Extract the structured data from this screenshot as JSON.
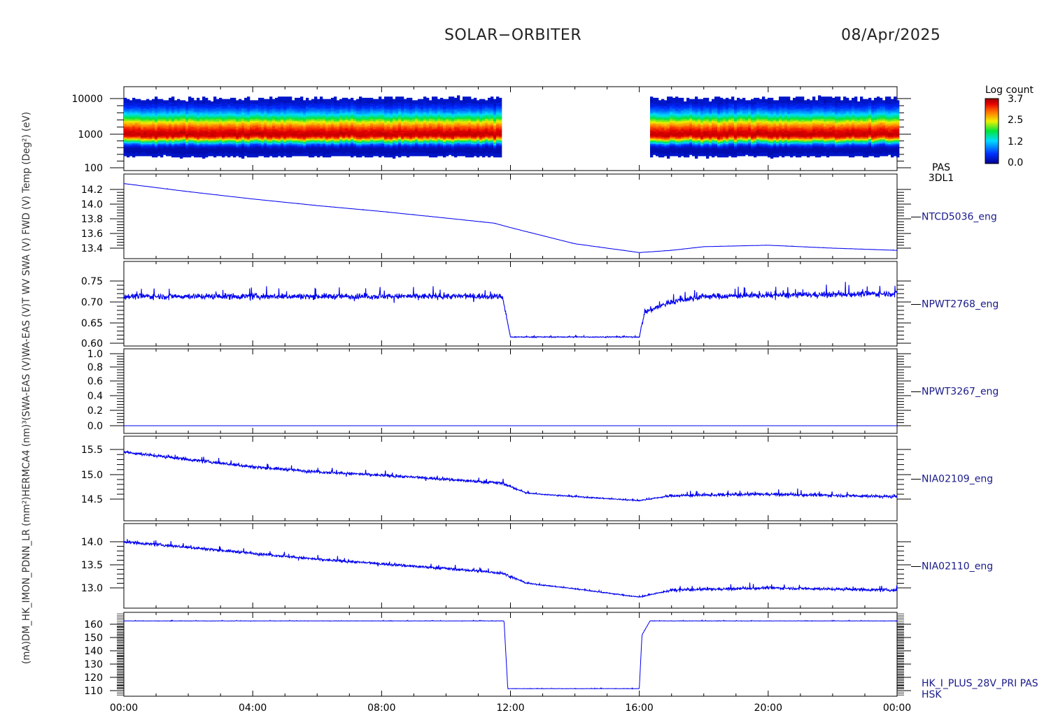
{
  "header": {
    "title": "SOLAR−ORBITER",
    "date": "08/Apr/2025"
  },
  "left_axis_label_overlay": "(mA)DM_HK_IMON_PDNN_LR (mm²)HERMCA4 (nm)³(SWA-EAS (V)WA-EAS (V)T WV SWA (V) FWD (V) Temp (Deg²) (eV)",
  "colorbar": {
    "title": "Log count",
    "ticks": [
      "3.7",
      "2.5",
      "1.2",
      "0.0"
    ]
  },
  "colors": {
    "trace": "#0000ee",
    "axis": "#000000",
    "label": "#1a1a8a"
  },
  "chart_data": [
    {
      "type": "heatmap",
      "panel": "PAS 3DL1",
      "name_lines": [
        "PAS",
        "3DL1"
      ],
      "y_scale": "log",
      "yticks": [
        "10000",
        "1000",
        "100"
      ],
      "ylim": [
        100,
        20000
      ],
      "x_range_hours": [
        0,
        24
      ],
      "data_gap_hours": [
        11.8,
        16.3
      ],
      "peak_energy": 900,
      "colorbar_range": [
        0.0,
        3.7
      ]
    },
    {
      "type": "line",
      "panel": "NTCD5036_eng",
      "name": "NTCD5036_eng",
      "yticks": [
        "14.2",
        "14.0",
        "13.8",
        "13.6",
        "13.4"
      ],
      "ylim": [
        13.3,
        14.33
      ],
      "x": [
        "00:00",
        "02:00",
        "04:00",
        "06:00",
        "08:00",
        "10:00",
        "11:30",
        "12:00",
        "14:00",
        "16:00",
        "17:00",
        "18:00",
        "20:00",
        "22:00",
        "24:00"
      ],
      "y": [
        14.28,
        14.17,
        14.07,
        13.98,
        13.9,
        13.81,
        13.74,
        13.68,
        13.46,
        13.34,
        13.37,
        13.42,
        13.44,
        13.4,
        13.37
      ]
    },
    {
      "type": "line",
      "panel": "NPWT2768_eng",
      "name": "NPWT2768_eng",
      "yticks": [
        "0.75",
        "0.70",
        "0.65",
        "0.60"
      ],
      "ylim": [
        0.598,
        0.78
      ],
      "x": [
        "00:00",
        "11:45",
        "12:00",
        "16:00",
        "16:10",
        "17:00",
        "18:00",
        "24:00"
      ],
      "y": [
        0.713,
        0.713,
        0.615,
        0.615,
        0.675,
        0.7,
        0.713,
        0.72
      ]
    },
    {
      "type": "line",
      "panel": "NPWT3267_eng",
      "name": "NPWT3267_eng",
      "yticks": [
        "1.0",
        "0.8",
        "0.6",
        "0.4",
        "0.2",
        "0.0"
      ],
      "ylim": [
        -0.02,
        1.02
      ],
      "x": [
        "00:00",
        "24:00"
      ],
      "y": [
        0.0,
        0.0
      ]
    },
    {
      "type": "line",
      "panel": "NIA02109_eng",
      "name": "NIA02109_eng",
      "yticks": [
        "15.5",
        "15.0",
        "14.5"
      ],
      "ylim": [
        14.1,
        15.65
      ],
      "x": [
        "00:00",
        "02:00",
        "04:00",
        "06:00",
        "08:00",
        "10:00",
        "11:45",
        "12:30",
        "14:00",
        "16:00",
        "17:00",
        "20:00",
        "24:00"
      ],
      "y": [
        15.45,
        15.3,
        15.15,
        15.05,
        14.98,
        14.9,
        14.82,
        14.62,
        14.55,
        14.47,
        14.57,
        14.6,
        14.55
      ]
    },
    {
      "type": "line",
      "panel": "NIA02110_eng",
      "name": "NIA02110_eng",
      "yticks": [
        "14.0",
        "13.5",
        "13.0"
      ],
      "ylim": [
        12.6,
        14.2
      ],
      "x": [
        "00:00",
        "02:00",
        "04:00",
        "06:00",
        "08:00",
        "10:00",
        "11:45",
        "12:30",
        "14:00",
        "16:00",
        "17:00",
        "20:00",
        "24:00"
      ],
      "y": [
        14.0,
        13.88,
        13.75,
        13.62,
        13.52,
        13.42,
        13.32,
        13.1,
        12.98,
        12.8,
        12.95,
        13.0,
        12.95
      ]
    },
    {
      "type": "line",
      "panel": "HK_I_PLUS_28V_PRI PAS HSK",
      "name_lines": [
        "HK_I_PLUS_28V_PRI PAS",
        "HSK"
      ],
      "yticks": [
        "160",
        "150",
        "140",
        "130",
        "120",
        "110"
      ],
      "ylim": [
        106,
        166
      ],
      "x": [
        "00:00",
        "11:48",
        "11:55",
        "16:00",
        "16:05",
        "16:20",
        "24:00"
      ],
      "y": [
        162.5,
        162.5,
        111.5,
        111.5,
        152,
        162.5,
        162.5
      ]
    }
  ],
  "x_axis": {
    "ticks": [
      "00:00",
      "04:00",
      "08:00",
      "12:00",
      "16:00",
      "20:00",
      "00:00"
    ]
  }
}
